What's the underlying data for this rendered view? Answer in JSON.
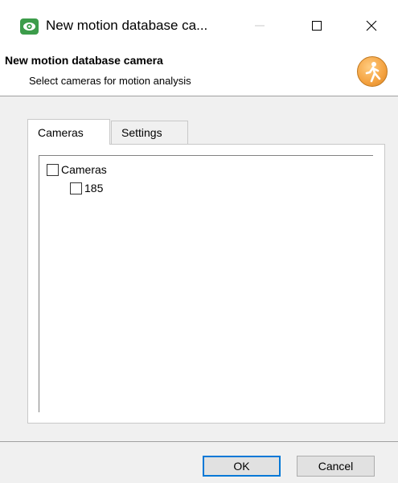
{
  "window": {
    "title": "New motion database ca...",
    "controls": {
      "minimize_icon": "minimize-icon",
      "maximize_icon": "maximize-icon",
      "close_icon": "close-icon"
    }
  },
  "header": {
    "title": "New motion database camera",
    "subtitle": "Select cameras for motion analysis",
    "logo_icon": "motion-person-icon"
  },
  "tabs": [
    {
      "label": "Cameras",
      "selected": true
    },
    {
      "label": "Settings",
      "selected": false
    }
  ],
  "tree": {
    "root": {
      "label": "Cameras",
      "checked": false
    },
    "children": [
      {
        "label": "185",
        "checked": false
      }
    ]
  },
  "buttons": {
    "ok_label": "OK",
    "cancel_label": "Cancel"
  },
  "colors": {
    "app_icon": "#3c9c4a",
    "logo_orange": "#f4a240",
    "ok_focus_border": "#0078d7"
  }
}
